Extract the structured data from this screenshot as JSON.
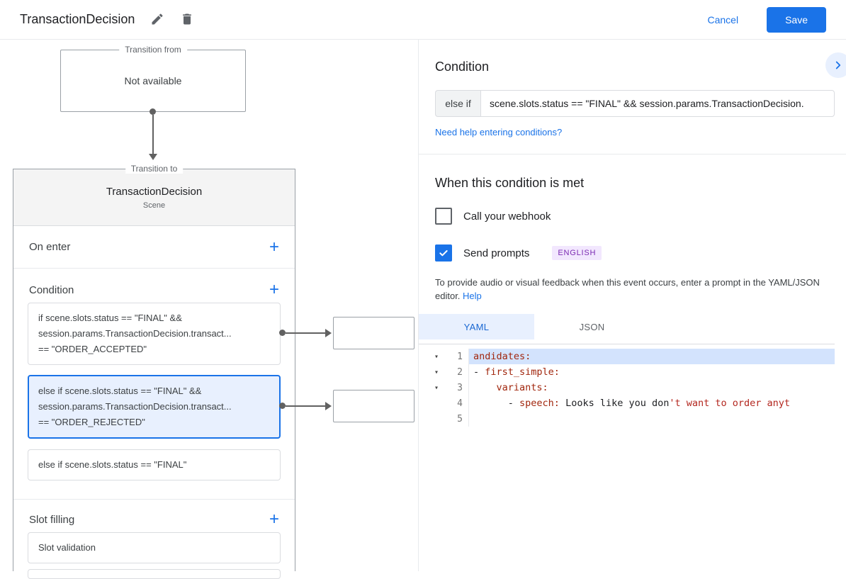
{
  "colors": {
    "accent": "#1a73e8",
    "accent-dark": "#1967d2",
    "selection": "#e8f0fe",
    "line-selection": "#d3e3fd",
    "border": "#dadce0",
    "canvas-border": "#9aa0a6",
    "text": "#202124",
    "text-secondary": "#5f6368",
    "arrow": "#616161",
    "code-key": "#a1260d",
    "code-string": "#b3261e",
    "badge-bg": "#f2e7fe",
    "badge-text": "#7b2ab2"
  },
  "header": {
    "title": "TransactionDecision",
    "cancel_label": "Cancel",
    "save_label": "Save"
  },
  "canvas": {
    "transition_from": {
      "label": "Transition from",
      "value": "Not available"
    },
    "scene": {
      "label": "Transition to",
      "title": "TransactionDecision",
      "subtitle": "Scene",
      "on_enter_label": "On enter",
      "condition": {
        "label": "Condition",
        "cards": [
          {
            "line1": "if scene.slots.status == \"FINAL\" &&",
            "line2": "session.params.TransactionDecision.transact...",
            "line3": "== \"ORDER_ACCEPTED\""
          },
          {
            "line1": "else if scene.slots.status == \"FINAL\" &&",
            "line2": "session.params.TransactionDecision.transact...",
            "line3": "== \"ORDER_REJECTED\""
          },
          {
            "line1": "else if scene.slots.status == \"FINAL\""
          }
        ]
      },
      "slot_filling": {
        "label": "Slot filling",
        "card": "Slot validation"
      }
    }
  },
  "panel": {
    "condition": {
      "heading": "Condition",
      "operator": "else if",
      "expression": "scene.slots.status == \"FINAL\" && session.params.TransactionDecision.",
      "help": "Need help entering conditions?"
    },
    "when": {
      "heading": "When this condition is met",
      "webhook_label": "Call your webhook",
      "prompts_label": "Send prompts",
      "badge": "ENGLISH",
      "description": "To provide audio or visual feedback when this event occurs, enter a prompt in the YAML/JSON editor.",
      "help": "Help"
    },
    "editor": {
      "tabs": {
        "yaml": "YAML",
        "json": "JSON"
      },
      "gutter": [
        "1",
        "2",
        "3",
        "4",
        "5"
      ],
      "code": {
        "l1": {
          "key": "andidates:"
        },
        "l2": {
          "plain": "- ",
          "key": "first_simple:"
        },
        "l3": {
          "plain": "    ",
          "key": "variants:"
        },
        "l4": {
          "plain": "      - ",
          "key": "speech:",
          "text": " Looks like you don",
          "string": "'t want to order anyt"
        }
      }
    }
  }
}
